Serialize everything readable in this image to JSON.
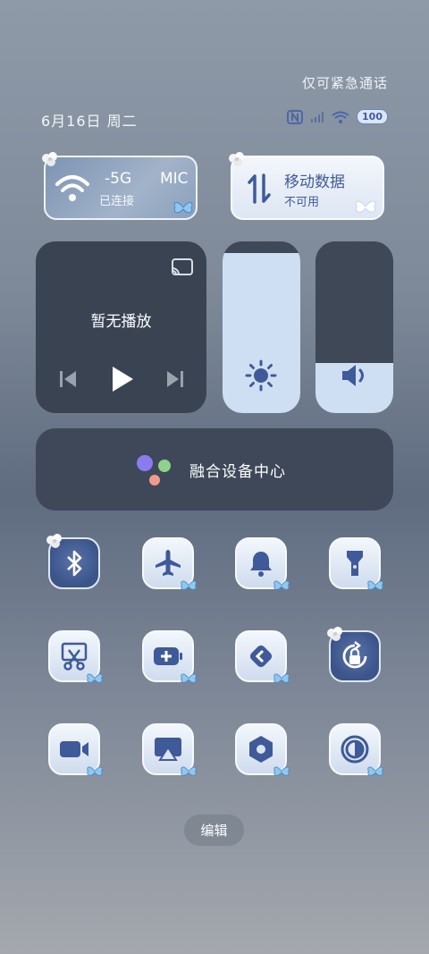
{
  "status_bar": {
    "emergency_text": "仅可紧急通话",
    "date": "6月16日 周二",
    "battery": "100",
    "icons": [
      "nfc-icon",
      "signal-icon",
      "wifi-icon",
      "battery-icon"
    ]
  },
  "wifi_tile": {
    "ssid_part": "-5G",
    "status": "已连接",
    "extra": "MIC"
  },
  "data_tile": {
    "title": "移动数据",
    "status": "不可用"
  },
  "media": {
    "title": "暂无播放"
  },
  "sliders": {
    "brightness_level": 0.93,
    "volume_level": 0.29
  },
  "fusion": {
    "label": "融合设备中心"
  },
  "quick_toggles": [
    {
      "icon": "bluetooth-icon",
      "active": true
    },
    {
      "icon": "airplane-icon",
      "active": false
    },
    {
      "icon": "bell-icon",
      "active": false
    },
    {
      "icon": "flashlight-icon",
      "active": false
    },
    {
      "icon": "screenshot-icon",
      "active": false
    },
    {
      "icon": "battery-saver-icon",
      "active": false
    },
    {
      "icon": "share-icon",
      "active": false
    },
    {
      "icon": "rotation-lock-icon",
      "active": true
    },
    {
      "icon": "screen-record-icon",
      "active": false
    },
    {
      "icon": "screen-cast-icon",
      "active": false
    },
    {
      "icon": "settings-hex-icon",
      "active": false
    },
    {
      "icon": "dark-mode-icon",
      "active": false
    }
  ],
  "edit_button": "编辑",
  "colors": {
    "accent": "#3f5a99",
    "tile_light": "#e6edf7",
    "dark_panel": "#3a4352"
  }
}
